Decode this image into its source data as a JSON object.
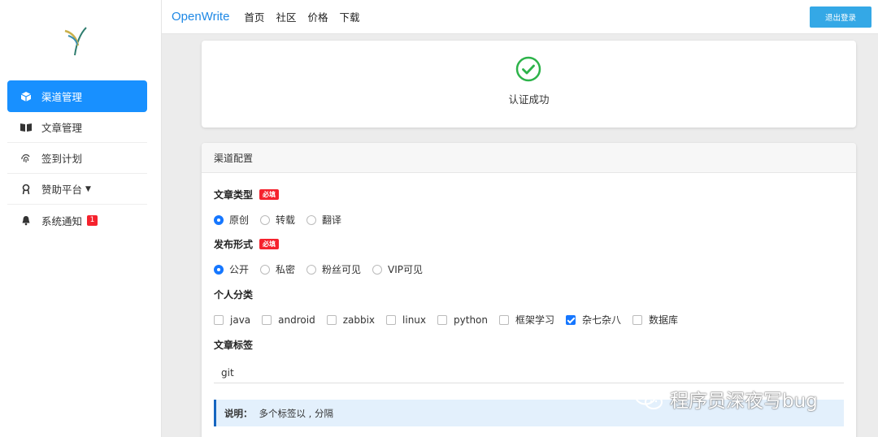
{
  "sidebar": {
    "items": [
      {
        "label": "渠道管理",
        "icon": "cube-icon",
        "active": true
      },
      {
        "label": "文章管理",
        "icon": "book-icon"
      },
      {
        "label": "签到计划",
        "icon": "fingerprint-icon"
      },
      {
        "label": "赞助平台",
        "icon": "medal-icon",
        "has_dropdown": true
      },
      {
        "label": "系统通知",
        "icon": "bell-icon",
        "badge": "1"
      }
    ]
  },
  "header": {
    "brand": "OpenWrite",
    "nav": [
      "首页",
      "社区",
      "价格",
      "下载"
    ],
    "logout_label": "退出登录"
  },
  "success": {
    "text": "认证成功"
  },
  "config": {
    "title": "渠道配置",
    "article_type": {
      "label": "文章类型",
      "required": "必填",
      "options": [
        "原创",
        "转载",
        "翻译"
      ],
      "selected": "原创"
    },
    "publish_form": {
      "label": "发布形式",
      "required": "必填",
      "options": [
        "公开",
        "私密",
        "粉丝可见",
        "VIP可见"
      ],
      "selected": "公开"
    },
    "category": {
      "label": "个人分类",
      "options": [
        "java",
        "android",
        "zabbix",
        "linux",
        "python",
        "框架学习",
        "杂七杂八",
        "数据库"
      ],
      "checked": [
        "杂七杂八"
      ]
    },
    "tags": {
      "label": "文章标签",
      "value": "git"
    },
    "note": {
      "label": "说明：",
      "text": "多个标签以 , 分隔"
    }
  },
  "watermark": "程序员深夜写bug",
  "colors": {
    "primary": "#1890ff",
    "brand": "#1e88e5",
    "success": "#2db34a",
    "required": "#f5222d",
    "logout_button": "#34a8e6"
  }
}
